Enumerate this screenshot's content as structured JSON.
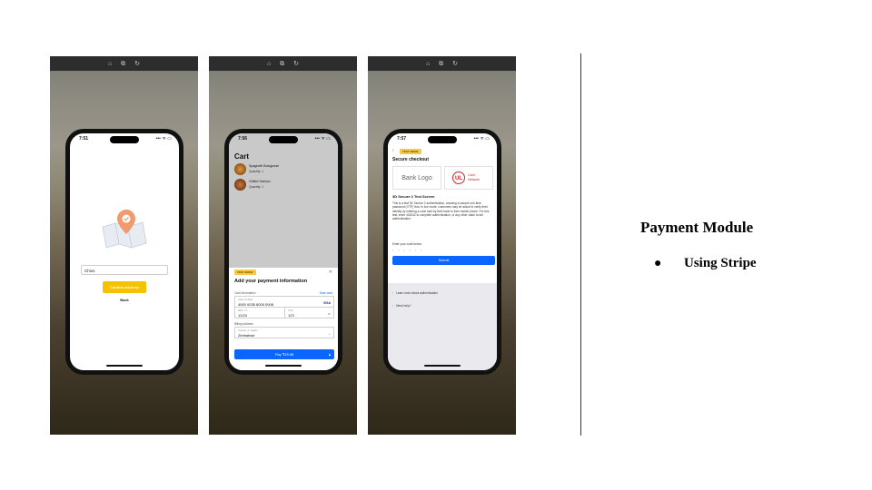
{
  "slide": {
    "title": "Payment Module",
    "bullets": [
      "Using Stripe"
    ]
  },
  "toolbar": {
    "icons": [
      "home-icon",
      "screens-icon",
      "rotate-icon"
    ]
  },
  "status_icons": "••• ᯤ ▭",
  "screen1": {
    "time": "7:51",
    "city_value": "Chios",
    "confirm_label": "Confirm Address",
    "back_label": "Back"
  },
  "screen2": {
    "time": "7:56",
    "cart_title": "Cart",
    "items": [
      {
        "name": "Spaghetti Bolognese",
        "quantity": "Quantity: 1"
      },
      {
        "name": "Grilled Salmon",
        "quantity": "Quantity: 1"
      }
    ],
    "test_badge": "TEST MODE",
    "close": "✕",
    "sheet_title": "Add your payment information",
    "card_info_label": "Card information",
    "scan_card": "Scan card",
    "card_number_label": "Card number",
    "card_number": "4000 0035 6000 0008",
    "card_brand": "VISA",
    "exp_label": "MM / YY",
    "exp_value": "12/24",
    "cvc_label": "CVC",
    "cvc_value": "123",
    "billing_label": "Billing address",
    "country_label": "Country or region",
    "country_value": "Zimbabwe",
    "pay_label": "Pay ₹29.58"
  },
  "screen3": {
    "time": "7:57",
    "test_badge": "TEST MODE",
    "back": "‹",
    "secure_title": "Secure checkout",
    "bank_logo": "Bank Logo",
    "ul_mark": "UL",
    "network_line1": "Card",
    "network_line2": "Network",
    "ds_title": "3D Secure 2 Test Screen",
    "ds_body": "This is a test 3D Secure 2 authentication, showing a sample one-time password (OTP) flow. In live mode, customers may be asked to verify their identity by entering a code sent by their bank to their mobile phone. For this test, enter 424242 to complete authentication, or any other value to fail authentication.",
    "code_label": "Enter your code below:",
    "code_placeholder": "• • • • • •",
    "submit_label": "Submit",
    "learn_more": "Learn more about authentication",
    "need_help": "Need help?"
  }
}
